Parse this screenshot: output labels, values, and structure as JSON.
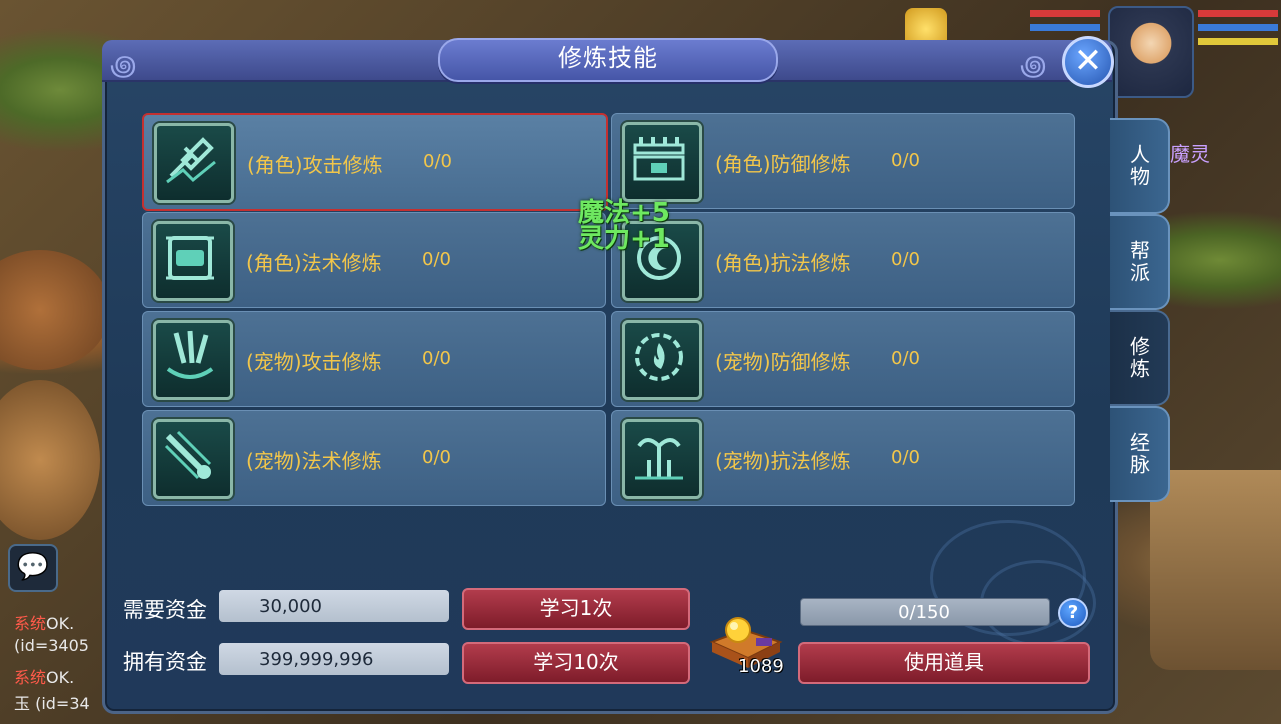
{
  "window": {
    "title": "修炼技能",
    "close_label": "✕"
  },
  "tabs": [
    {
      "label": "人物",
      "active": false
    },
    {
      "label": "帮派",
      "active": false
    },
    {
      "label": "修炼",
      "active": true
    },
    {
      "label": "经脉",
      "active": false
    }
  ],
  "skills": [
    {
      "name": "(角色)攻击修炼",
      "value": "0/0",
      "selected": true,
      "icon": "sword-icon"
    },
    {
      "name": "(角色)防御修炼",
      "value": "0/0",
      "selected": false,
      "icon": "wall-icon"
    },
    {
      "name": "(角色)法术修炼",
      "value": "0/0",
      "selected": false,
      "icon": "scroll-icon"
    },
    {
      "name": "(角色)抗法修炼",
      "value": "0/0",
      "selected": false,
      "icon": "moon-shield-icon"
    },
    {
      "name": "(宠物)攻击修炼",
      "value": "0/0",
      "selected": false,
      "icon": "claw-icon"
    },
    {
      "name": "(宠物)防御修炼",
      "value": "0/0",
      "selected": false,
      "icon": "flame-ring-icon"
    },
    {
      "name": "(宠物)法术修炼",
      "value": "0/0",
      "selected": false,
      "icon": "comet-icon"
    },
    {
      "name": "(宠物)抗法修炼",
      "value": "0/0",
      "selected": false,
      "icon": "fountain-icon"
    }
  ],
  "floating_text": {
    "line1": "魔法+5",
    "line2": "灵力+1"
  },
  "funds": {
    "required_label": "需要资金",
    "required_value": "30,000",
    "owned_label": "拥有资金",
    "owned_value": "399,999,996"
  },
  "buttons": {
    "learn_once": "学习1次",
    "learn_ten": "学习10次",
    "use_item": "使用道具"
  },
  "item": {
    "count": "1089",
    "icon": "gold-treasure-icon"
  },
  "progress": {
    "text": "0/150",
    "fraction": 0
  },
  "help_label": "?",
  "background": {
    "side_name": "魔灵",
    "chat": [
      {
        "tag": "系统",
        "text": "OK."
      },
      {
        "tag": "",
        "text": "(id=3405"
      },
      {
        "tag": "系统",
        "text": "OK."
      },
      {
        "tag": "",
        "text": "玉 (id=34"
      }
    ]
  },
  "colors": {
    "skill_text": "#f2c64a",
    "selected_border": "#c43030",
    "button_red": "#9a2a3a",
    "float_text": "#6ee860"
  }
}
